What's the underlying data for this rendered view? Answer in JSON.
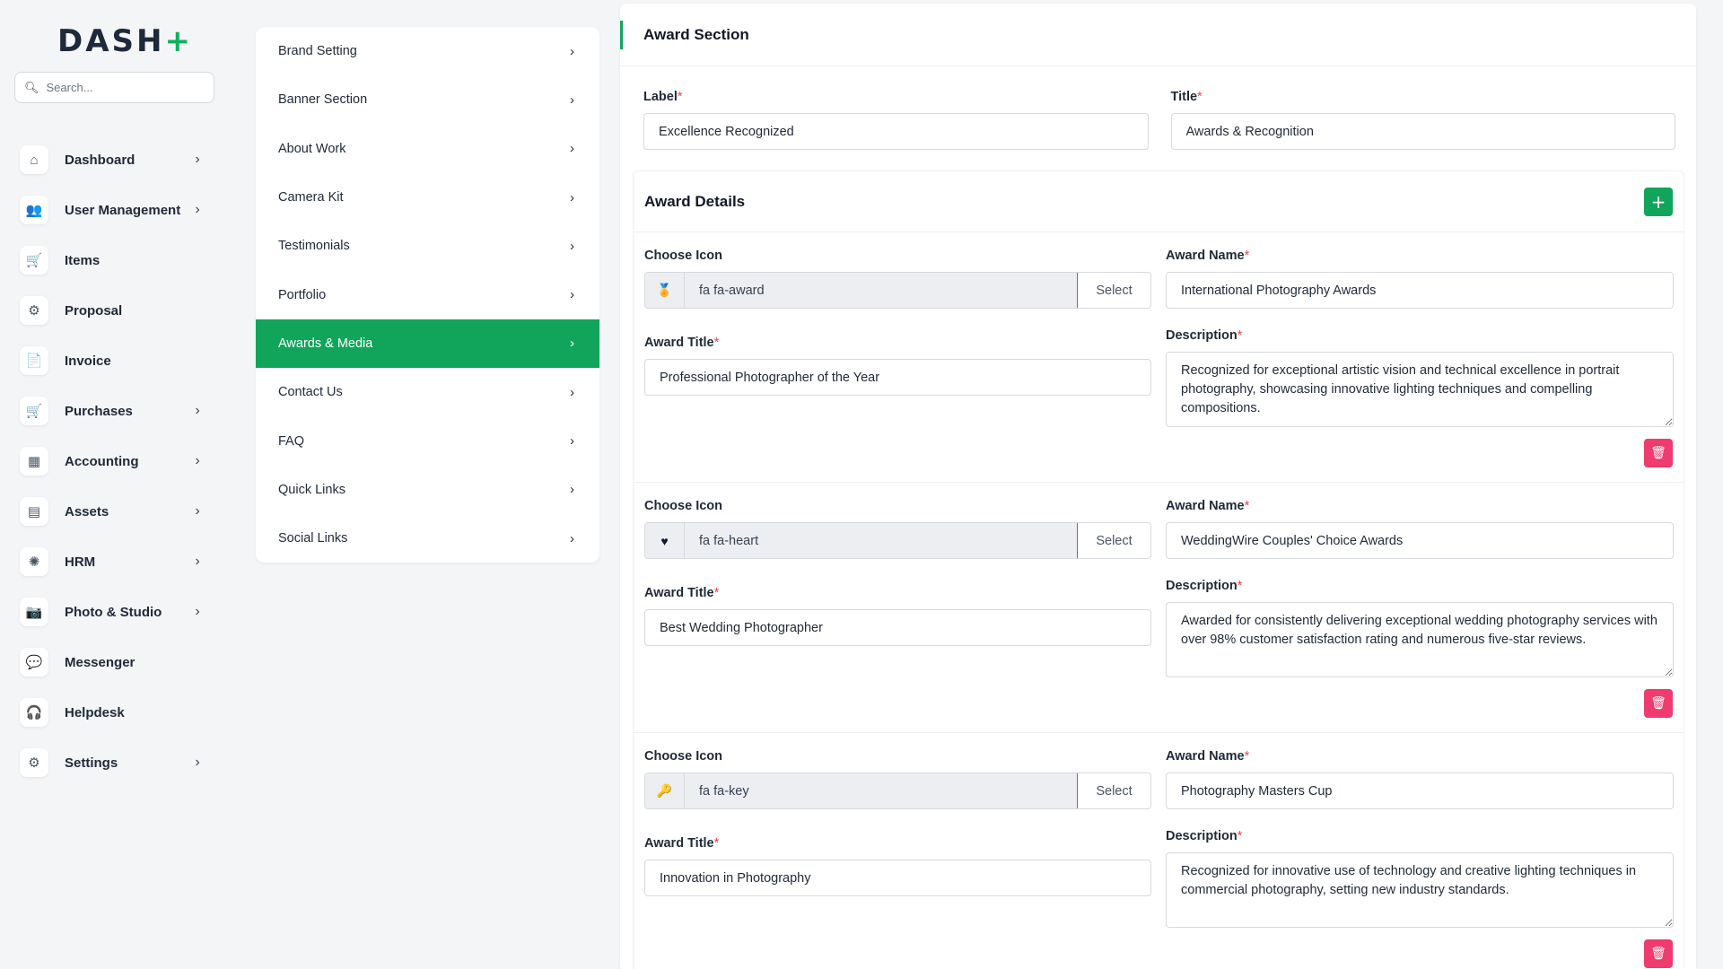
{
  "app": {
    "logo_text": "DASH",
    "search_placeholder": "Search..."
  },
  "sidebar": {
    "items": [
      {
        "label": "Dashboard",
        "icon": "⌂",
        "has_arrow": true
      },
      {
        "label": "User Management",
        "icon": "👥",
        "has_arrow": true
      },
      {
        "label": "Items",
        "icon": "🛒",
        "has_arrow": false
      },
      {
        "label": "Proposal",
        "icon": "⚙",
        "has_arrow": false
      },
      {
        "label": "Invoice",
        "icon": "📄",
        "has_arrow": false
      },
      {
        "label": "Purchases",
        "icon": "🛒",
        "has_arrow": true
      },
      {
        "label": "Accounting",
        "icon": "▦",
        "has_arrow": true
      },
      {
        "label": "Assets",
        "icon": "▤",
        "has_arrow": true
      },
      {
        "label": "HRM",
        "icon": "✺",
        "has_arrow": true
      },
      {
        "label": "Photo & Studio",
        "icon": "📷",
        "has_arrow": true
      },
      {
        "label": "Messenger",
        "icon": "💬",
        "has_arrow": false
      },
      {
        "label": "Helpdesk",
        "icon": "🎧",
        "has_arrow": false
      },
      {
        "label": "Settings",
        "icon": "⚙",
        "has_arrow": true
      }
    ]
  },
  "settings_menu": {
    "items": [
      {
        "label": "Brand Setting",
        "active": false
      },
      {
        "label": "Banner Section",
        "active": false
      },
      {
        "label": "About Work",
        "active": false
      },
      {
        "label": "Camera Kit",
        "active": false
      },
      {
        "label": "Testimonials",
        "active": false
      },
      {
        "label": "Portfolio",
        "active": false
      },
      {
        "label": "Awards & Media",
        "active": true
      },
      {
        "label": "Contact Us",
        "active": false
      },
      {
        "label": "FAQ",
        "active": false
      },
      {
        "label": "Quick Links",
        "active": false
      },
      {
        "label": "Social Links",
        "active": false
      }
    ]
  },
  "award_section": {
    "title": "Award Section",
    "label_label": "Label",
    "label_value": "Excellence Recognized",
    "title_label": "Title",
    "title_value": "Awards & Recognition",
    "details_title": "Award Details",
    "add_button": "+",
    "choose_icon_label": "Choose Icon",
    "award_name_label": "Award Name",
    "award_title_label": "Award Title",
    "description_label": "Description",
    "select_button": "Select",
    "required_mark": "*",
    "delete_icon": "🗑",
    "awards": [
      {
        "icon_class": "fa fa-award",
        "icon_glyph": "🏅",
        "award_name": "International Photography Awards",
        "award_title": "Professional Photographer of the Year",
        "description": "Recognized for exceptional artistic vision and technical excellence in portrait photography, showcasing innovative lighting techniques and compelling compositions."
      },
      {
        "icon_class": "fa fa-heart",
        "icon_glyph": "♥",
        "award_name": "WeddingWire Couples' Choice Awards",
        "award_title": "Best Wedding Photographer",
        "description": "Awarded for consistently delivering exceptional wedding photography services with over 98% customer satisfaction rating and numerous five-star reviews."
      },
      {
        "icon_class": "fa fa-key",
        "icon_glyph": "🔑",
        "award_name": "Photography Masters Cup",
        "award_title": "Innovation in Photography",
        "description": "Recognized for innovative use of technology and creative lighting techniques in commercial photography, setting new industry standards."
      }
    ]
  }
}
